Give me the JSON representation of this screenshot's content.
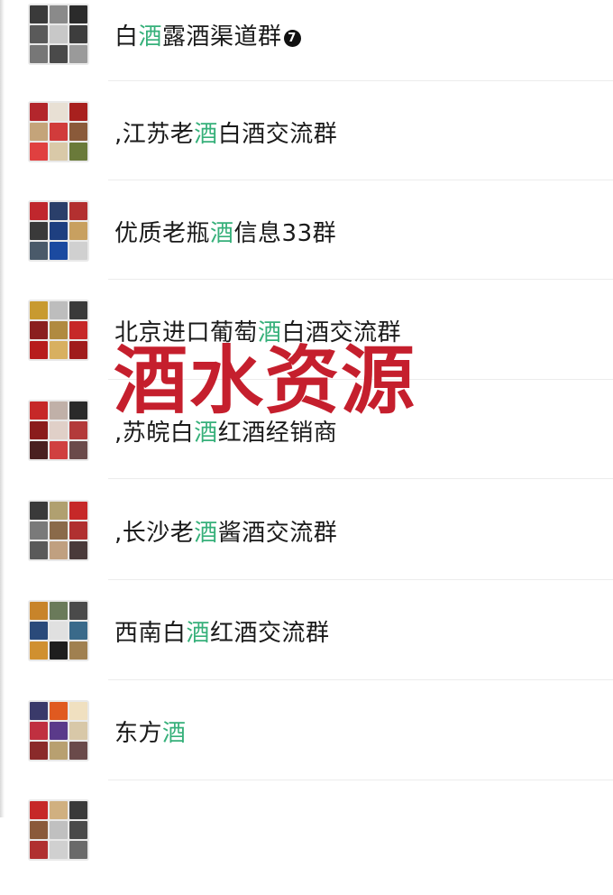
{
  "groups": [
    {
      "prefix": "白",
      "highlight": "酒",
      "suffix": "露酒渠道群",
      "badge": "7",
      "tiles": [
        "#3a3a3a",
        "#8a8a8a",
        "#2b2b2b",
        "#5a5a5a",
        "#c8c8c8",
        "#3d3d3d",
        "#777777",
        "#4a4a4a",
        "#9a9a9a"
      ]
    },
    {
      "prefix": ",江苏老",
      "highlight": "酒",
      "suffix": "白酒交流群",
      "badge": "",
      "tiles": [
        "#b3262c",
        "#e8e0d4",
        "#a8201e",
        "#c4a47a",
        "#d13b3b",
        "#8a5a3a",
        "#e04040",
        "#d9c9a8",
        "#6a7a3a"
      ]
    },
    {
      "prefix": "优质老瓶",
      "highlight": "酒",
      "suffix": "信息33群",
      "badge": "",
      "tiles": [
        "#c0272d",
        "#2a3f6a",
        "#b33030",
        "#3a3a3a",
        "#1e3f80",
        "#c8a060",
        "#4a5a6a",
        "#1b4aa0",
        "#d0d0d0"
      ]
    },
    {
      "prefix": "北京进口葡萄",
      "highlight": "酒",
      "suffix": "白酒交流群",
      "badge": "",
      "tiles": [
        "#c89a30",
        "#bdbdbd",
        "#3a3a3a",
        "#8a1f1f",
        "#b08a40",
        "#c62828",
        "#b71c1c",
        "#d8b060",
        "#a01c1c"
      ]
    },
    {
      "prefix": ",苏皖白",
      "highlight": "酒",
      "suffix": "红酒经销商",
      "badge": "",
      "tiles": [
        "#c62828",
        "#c0b0a8",
        "#2a2a2a",
        "#8a1c1c",
        "#e0d0c8",
        "#b33a3a",
        "#4a2020",
        "#d04040",
        "#6a4a4a"
      ]
    },
    {
      "prefix": ",长沙老",
      "highlight": "酒",
      "suffix": "酱酒交流群",
      "badge": "",
      "tiles": [
        "#3a3a3a",
        "#b0a070",
        "#c62828",
        "#7a7a7a",
        "#8a6a4a",
        "#b03030",
        "#5a5a5a",
        "#c0a080",
        "#4a3a3a"
      ]
    },
    {
      "prefix": "西南白",
      "highlight": "酒",
      "suffix": "红酒交流群",
      "badge": "",
      "tiles": [
        "#c8842a",
        "#6a7a5a",
        "#4a4a4a",
        "#2a4a7a",
        "#e0e0e0",
        "#3a6a8a",
        "#d09030",
        "#1e1e1e",
        "#a08050"
      ]
    },
    {
      "prefix": "东方",
      "highlight": "酒",
      "suffix": "",
      "badge": "",
      "tiles": [
        "#3a3a6a",
        "#e05a20",
        "#f0e0c0",
        "#c03040",
        "#5a3a8a",
        "#d8c8a8",
        "#8a2a2a",
        "#b8a070",
        "#6a4a4a"
      ]
    },
    {
      "prefix": "",
      "highlight": "",
      "suffix": "",
      "badge": "",
      "tiles": [
        "#c62828",
        "#d0b080",
        "#3a3a3a",
        "#8a5a3a",
        "#c0c0c0",
        "#4a4a4a",
        "#b03030",
        "#d0d0d0",
        "#6a6a6a"
      ]
    }
  ],
  "watermark": {
    "text": "酒水资源"
  }
}
